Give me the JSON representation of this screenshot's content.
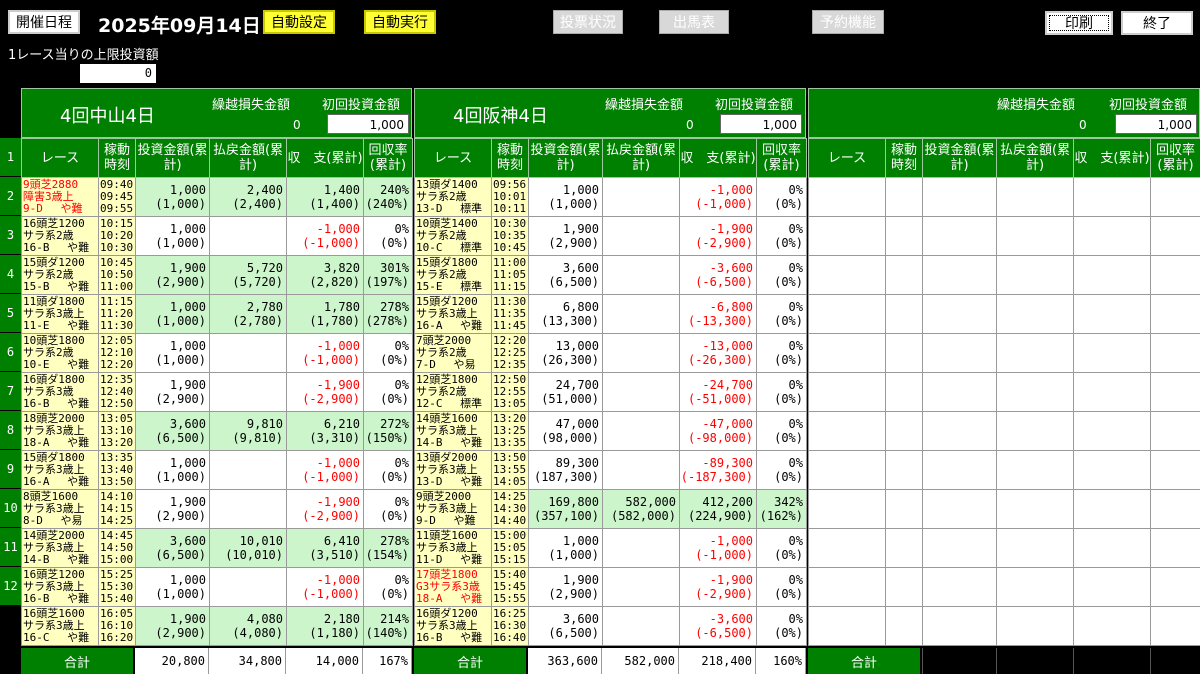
{
  "toolbar": {
    "schedule_label": "開催日程",
    "date": "2025年09月14日",
    "auto_setting_label": "自動設定",
    "auto_run_label": "自動実行",
    "vote_status_label": "投票状況",
    "race_card_label": "出馬表",
    "reserve_label": "予約機能",
    "print_label": "印刷",
    "exit_label": "終了"
  },
  "limit": {
    "label": "1レース当りの上限投資額",
    "value": "0"
  },
  "columns": {
    "race": "レース",
    "time": "稼動時刻",
    "invest": "投資金額(累計)",
    "payout": "払戻金額(累計)",
    "balance": "収　支(累計)",
    "rate": "回収率(累計)"
  },
  "colors": {
    "header_green": "#008000",
    "race_yellow": "#ffffc0",
    "win_green": "#ccf5cc",
    "loss_red": "#ff0000",
    "button_yellow": "#ffff33"
  },
  "race_numbers": [
    "1",
    "2",
    "3",
    "4",
    "5",
    "6",
    "7",
    "8",
    "9",
    "10",
    "11",
    "12"
  ],
  "venues": [
    {
      "name": "4回中山4日",
      "carry_label": "繰越損失金額",
      "carry_value": "0",
      "first_label": "初回投資金額",
      "first_value": "1,000",
      "rows": [
        {
          "info": [
            "9頭芝2880",
            "障害3歳上",
            "9-D　 や難"
          ],
          "red": true,
          "time": [
            "09:40",
            "09:45",
            "09:55"
          ],
          "invest": "1,000",
          "invest_c": "(1,000)",
          "payout": "2,400",
          "payout_c": "(2,400)",
          "bal": "1,400",
          "bal_c": "(1,400)",
          "rate": "240%",
          "rate_c": "(240%)",
          "win": true,
          "neg": false
        },
        {
          "info": [
            "16頭芝1200",
            "サラ系2歳",
            "16-B　 や難"
          ],
          "red": false,
          "time": [
            "10:15",
            "10:20",
            "10:30"
          ],
          "invest": "1,000",
          "invest_c": "(1,000)",
          "payout": "",
          "payout_c": "",
          "bal": "-1,000",
          "bal_c": "(-1,000)",
          "rate": "0%",
          "rate_c": "(0%)",
          "win": false,
          "neg": true
        },
        {
          "info": [
            "15頭ダ1200",
            "サラ系2歳",
            "15-B　 や難"
          ],
          "red": false,
          "time": [
            "10:45",
            "10:50",
            "11:00"
          ],
          "invest": "1,900",
          "invest_c": "(2,900)",
          "payout": "5,720",
          "payout_c": "(5,720)",
          "bal": "3,820",
          "bal_c": "(2,820)",
          "rate": "301%",
          "rate_c": "(197%)",
          "win": true,
          "neg": false
        },
        {
          "info": [
            "11頭ダ1800",
            "サラ系3歳上",
            "11-E　 や難"
          ],
          "red": false,
          "time": [
            "11:15",
            "11:20",
            "11:30"
          ],
          "invest": "1,000",
          "invest_c": "(1,000)",
          "payout": "2,780",
          "payout_c": "(2,780)",
          "bal": "1,780",
          "bal_c": "(1,780)",
          "rate": "278%",
          "rate_c": "(278%)",
          "win": true,
          "neg": false
        },
        {
          "info": [
            "10頭芝1800",
            "サラ系2歳",
            "10-E　 や難"
          ],
          "red": false,
          "time": [
            "12:05",
            "12:10",
            "12:20"
          ],
          "invest": "1,000",
          "invest_c": "(1,000)",
          "payout": "",
          "payout_c": "",
          "bal": "-1,000",
          "bal_c": "(-1,000)",
          "rate": "0%",
          "rate_c": "(0%)",
          "win": false,
          "neg": true
        },
        {
          "info": [
            "16頭ダ1800",
            "サラ系3歳",
            "16-B　 や難"
          ],
          "red": false,
          "time": [
            "12:35",
            "12:40",
            "12:50"
          ],
          "invest": "1,900",
          "invest_c": "(2,900)",
          "payout": "",
          "payout_c": "",
          "bal": "-1,900",
          "bal_c": "(-2,900)",
          "rate": "0%",
          "rate_c": "(0%)",
          "win": false,
          "neg": true
        },
        {
          "info": [
            "18頭芝2000",
            "サラ系3歳上",
            "18-A　 や難"
          ],
          "red": false,
          "time": [
            "13:05",
            "13:10",
            "13:20"
          ],
          "invest": "3,600",
          "invest_c": "(6,500)",
          "payout": "9,810",
          "payout_c": "(9,810)",
          "bal": "6,210",
          "bal_c": "(3,310)",
          "rate": "272%",
          "rate_c": "(150%)",
          "win": true,
          "neg": false
        },
        {
          "info": [
            "15頭ダ1800",
            "サラ系3歳上",
            "16-A　 や難"
          ],
          "red": false,
          "time": [
            "13:35",
            "13:40",
            "13:50"
          ],
          "invest": "1,000",
          "invest_c": "(1,000)",
          "payout": "",
          "payout_c": "",
          "bal": "-1,000",
          "bal_c": "(-1,000)",
          "rate": "0%",
          "rate_c": "(0%)",
          "win": false,
          "neg": true
        },
        {
          "info": [
            "8頭芝1600",
            "サラ系3歳上",
            "8-D　 や易"
          ],
          "red": false,
          "time": [
            "14:10",
            "14:15",
            "14:25"
          ],
          "invest": "1,900",
          "invest_c": "(2,900)",
          "payout": "",
          "payout_c": "",
          "bal": "-1,900",
          "bal_c": "(-2,900)",
          "rate": "0%",
          "rate_c": "(0%)",
          "win": false,
          "neg": true
        },
        {
          "info": [
            "14頭芝2000",
            "サラ系3歳上",
            "14-B　 や難"
          ],
          "red": false,
          "time": [
            "14:45",
            "14:50",
            "15:00"
          ],
          "invest": "3,600",
          "invest_c": "(6,500)",
          "payout": "10,010",
          "payout_c": "(10,010)",
          "bal": "6,410",
          "bal_c": "(3,510)",
          "rate": "278%",
          "rate_c": "(154%)",
          "win": true,
          "neg": false
        },
        {
          "info": [
            "16頭芝1200",
            "サラ系3歳上",
            "16-B　 や難"
          ],
          "red": false,
          "time": [
            "15:25",
            "15:30",
            "15:40"
          ],
          "invest": "1,000",
          "invest_c": "(1,000)",
          "payout": "",
          "payout_c": "",
          "bal": "-1,000",
          "bal_c": "(-1,000)",
          "rate": "0%",
          "rate_c": "(0%)",
          "win": false,
          "neg": true
        },
        {
          "info": [
            "16頭芝1600",
            "サラ系3歳上",
            "16-C　 や難"
          ],
          "red": false,
          "time": [
            "16:05",
            "16:10",
            "16:20"
          ],
          "invest": "1,900",
          "invest_c": "(2,900)",
          "payout": "4,080",
          "payout_c": "(4,080)",
          "bal": "2,180",
          "bal_c": "(1,180)",
          "rate": "214%",
          "rate_c": "(140%)",
          "win": true,
          "neg": false
        }
      ],
      "total_label": "合計",
      "total_invest": "20,800",
      "total_payout": "34,800",
      "total_bal": "14,000",
      "total_rate": "167%"
    },
    {
      "name": "4回阪神4日",
      "carry_label": "繰越損失金額",
      "carry_value": "0",
      "first_label": "初回投資金額",
      "first_value": "1,000",
      "rows": [
        {
          "info": [
            "13頭ダ1400",
            "サラ系2歳",
            "13-D　 標準"
          ],
          "red": false,
          "time": [
            "09:56",
            "10:01",
            "10:11"
          ],
          "invest": "1,000",
          "invest_c": "(1,000)",
          "payout": "",
          "payout_c": "",
          "bal": "-1,000",
          "bal_c": "(-1,000)",
          "rate": "0%",
          "rate_c": "(0%)",
          "win": false,
          "neg": true
        },
        {
          "info": [
            "10頭芝1400",
            "サラ系2歳",
            "10-C　 標準"
          ],
          "red": false,
          "time": [
            "10:30",
            "10:35",
            "10:45"
          ],
          "invest": "1,900",
          "invest_c": "(2,900)",
          "payout": "",
          "payout_c": "",
          "bal": "-1,900",
          "bal_c": "(-2,900)",
          "rate": "0%",
          "rate_c": "(0%)",
          "win": false,
          "neg": true
        },
        {
          "info": [
            "15頭ダ1800",
            "サラ系2歳",
            "15-E　 標準"
          ],
          "red": false,
          "time": [
            "11:00",
            "11:05",
            "11:15"
          ],
          "invest": "3,600",
          "invest_c": "(6,500)",
          "payout": "",
          "payout_c": "",
          "bal": "-3,600",
          "bal_c": "(-6,500)",
          "rate": "0%",
          "rate_c": "(0%)",
          "win": false,
          "neg": true
        },
        {
          "info": [
            "15頭ダ1200",
            "サラ系3歳上",
            "16-A　 や難"
          ],
          "red": false,
          "time": [
            "11:30",
            "11:35",
            "11:45"
          ],
          "invest": "6,800",
          "invest_c": "(13,300)",
          "payout": "",
          "payout_c": "",
          "bal": "-6,800",
          "bal_c": "(-13,300)",
          "rate": "0%",
          "rate_c": "(0%)",
          "win": false,
          "neg": true
        },
        {
          "info": [
            "7頭芝2000",
            "サラ系2歳",
            "7-D　 や易"
          ],
          "red": false,
          "time": [
            "12:20",
            "12:25",
            "12:35"
          ],
          "invest": "13,000",
          "invest_c": "(26,300)",
          "payout": "",
          "payout_c": "",
          "bal": "-13,000",
          "bal_c": "(-26,300)",
          "rate": "0%",
          "rate_c": "(0%)",
          "win": false,
          "neg": true
        },
        {
          "info": [
            "12頭芝1800",
            "サラ系2歳",
            "12-C　 標準"
          ],
          "red": false,
          "time": [
            "12:50",
            "12:55",
            "13:05"
          ],
          "invest": "24,700",
          "invest_c": "(51,000)",
          "payout": "",
          "payout_c": "",
          "bal": "-24,700",
          "bal_c": "(-51,000)",
          "rate": "0%",
          "rate_c": "(0%)",
          "win": false,
          "neg": true
        },
        {
          "info": [
            "14頭芝1600",
            "サラ系3歳上",
            "14-B　 や難"
          ],
          "red": false,
          "time": [
            "13:20",
            "13:25",
            "13:35"
          ],
          "invest": "47,000",
          "invest_c": "(98,000)",
          "payout": "",
          "payout_c": "",
          "bal": "-47,000",
          "bal_c": "(-98,000)",
          "rate": "0%",
          "rate_c": "(0%)",
          "win": false,
          "neg": true
        },
        {
          "info": [
            "13頭ダ2000",
            "サラ系3歳上",
            "13-D　 や難"
          ],
          "red": false,
          "time": [
            "13:50",
            "13:55",
            "14:05"
          ],
          "invest": "89,300",
          "invest_c": "(187,300)",
          "payout": "",
          "payout_c": "",
          "bal": "-89,300",
          "bal_c": "(-187,300)",
          "rate": "0%",
          "rate_c": "(0%)",
          "win": false,
          "neg": true
        },
        {
          "info": [
            "9頭芝2000",
            "サラ系3歳上",
            "9-D　 や難"
          ],
          "red": false,
          "time": [
            "14:25",
            "14:30",
            "14:40"
          ],
          "invest": "169,800",
          "invest_c": "(357,100)",
          "payout": "582,000",
          "payout_c": "(582,000)",
          "bal": "412,200",
          "bal_c": "(224,900)",
          "rate": "342%",
          "rate_c": "(162%)",
          "win": true,
          "neg": false
        },
        {
          "info": [
            "11頭芝1600",
            "サラ系3歳上",
            "11-D　 や難"
          ],
          "red": false,
          "time": [
            "15:00",
            "15:05",
            "15:15"
          ],
          "invest": "1,000",
          "invest_c": "(1,000)",
          "payout": "",
          "payout_c": "",
          "bal": "-1,000",
          "bal_c": "(-1,000)",
          "rate": "0%",
          "rate_c": "(0%)",
          "win": false,
          "neg": true
        },
        {
          "info": [
            "17頭芝1800",
            "G3サラ系3歳",
            "18-A　 や難"
          ],
          "red": true,
          "time": [
            "15:40",
            "15:45",
            "15:55"
          ],
          "invest": "1,900",
          "invest_c": "(2,900)",
          "payout": "",
          "payout_c": "",
          "bal": "-1,900",
          "bal_c": "(-2,900)",
          "rate": "0%",
          "rate_c": "(0%)",
          "win": false,
          "neg": true
        },
        {
          "info": [
            "16頭ダ1200",
            "サラ系3歳上",
            "16-B　 や難"
          ],
          "red": false,
          "time": [
            "16:25",
            "16:30",
            "16:40"
          ],
          "invest": "3,600",
          "invest_c": "(6,500)",
          "payout": "",
          "payout_c": "",
          "bal": "-3,600",
          "bal_c": "(-6,500)",
          "rate": "0%",
          "rate_c": "(0%)",
          "win": false,
          "neg": true
        }
      ],
      "total_label": "合計",
      "total_invest": "363,600",
      "total_payout": "582,000",
      "total_bal": "218,400",
      "total_rate": "160%"
    },
    {
      "name": "",
      "carry_label": "繰越損失金額",
      "carry_value": "0",
      "first_label": "初回投資金額",
      "first_value": "1,000",
      "rows": [],
      "total_label": "合計",
      "total_invest": "",
      "total_payout": "",
      "total_bal": "",
      "total_rate": ""
    }
  ]
}
